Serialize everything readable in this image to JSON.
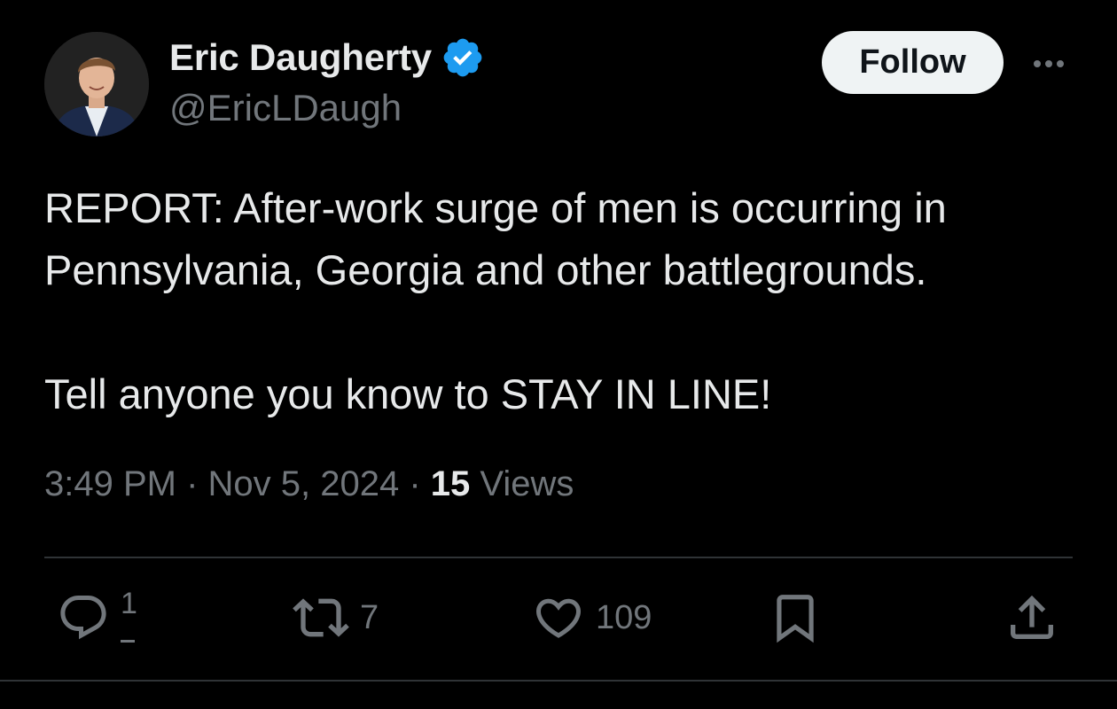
{
  "author": {
    "display_name": "Eric Daugherty",
    "handle": "@EricLDaugh",
    "verified": true
  },
  "header": {
    "follow_label": "Follow"
  },
  "tweet": {
    "paragraph_1_line_1": "REPORT: After-work surge of men is occurring in",
    "paragraph_1_line_2": "Pennsylvania, Georgia and other battlegrounds.",
    "paragraph_2": "Tell anyone you know to STAY IN LINE!"
  },
  "meta": {
    "time": "3:49 PM",
    "separator": " · ",
    "date": "Nov 5, 2024",
    "views_count": "15",
    "views_label": " Views"
  },
  "actions": {
    "reply_count": "1",
    "repost_count": "7",
    "like_count": "109"
  },
  "icons": {
    "reply": "reply-icon",
    "repost": "repost-icon",
    "like": "heart-icon",
    "bookmark": "bookmark-icon",
    "share": "share-icon",
    "more": "more-icon",
    "verified": "verified-badge-icon"
  },
  "colors": {
    "background": "#000000",
    "text_primary": "#e7e9ea",
    "text_secondary": "#71767b",
    "verified_blue": "#1d9bf0",
    "divider": "#2f3336",
    "follow_bg": "#eff3f4"
  }
}
